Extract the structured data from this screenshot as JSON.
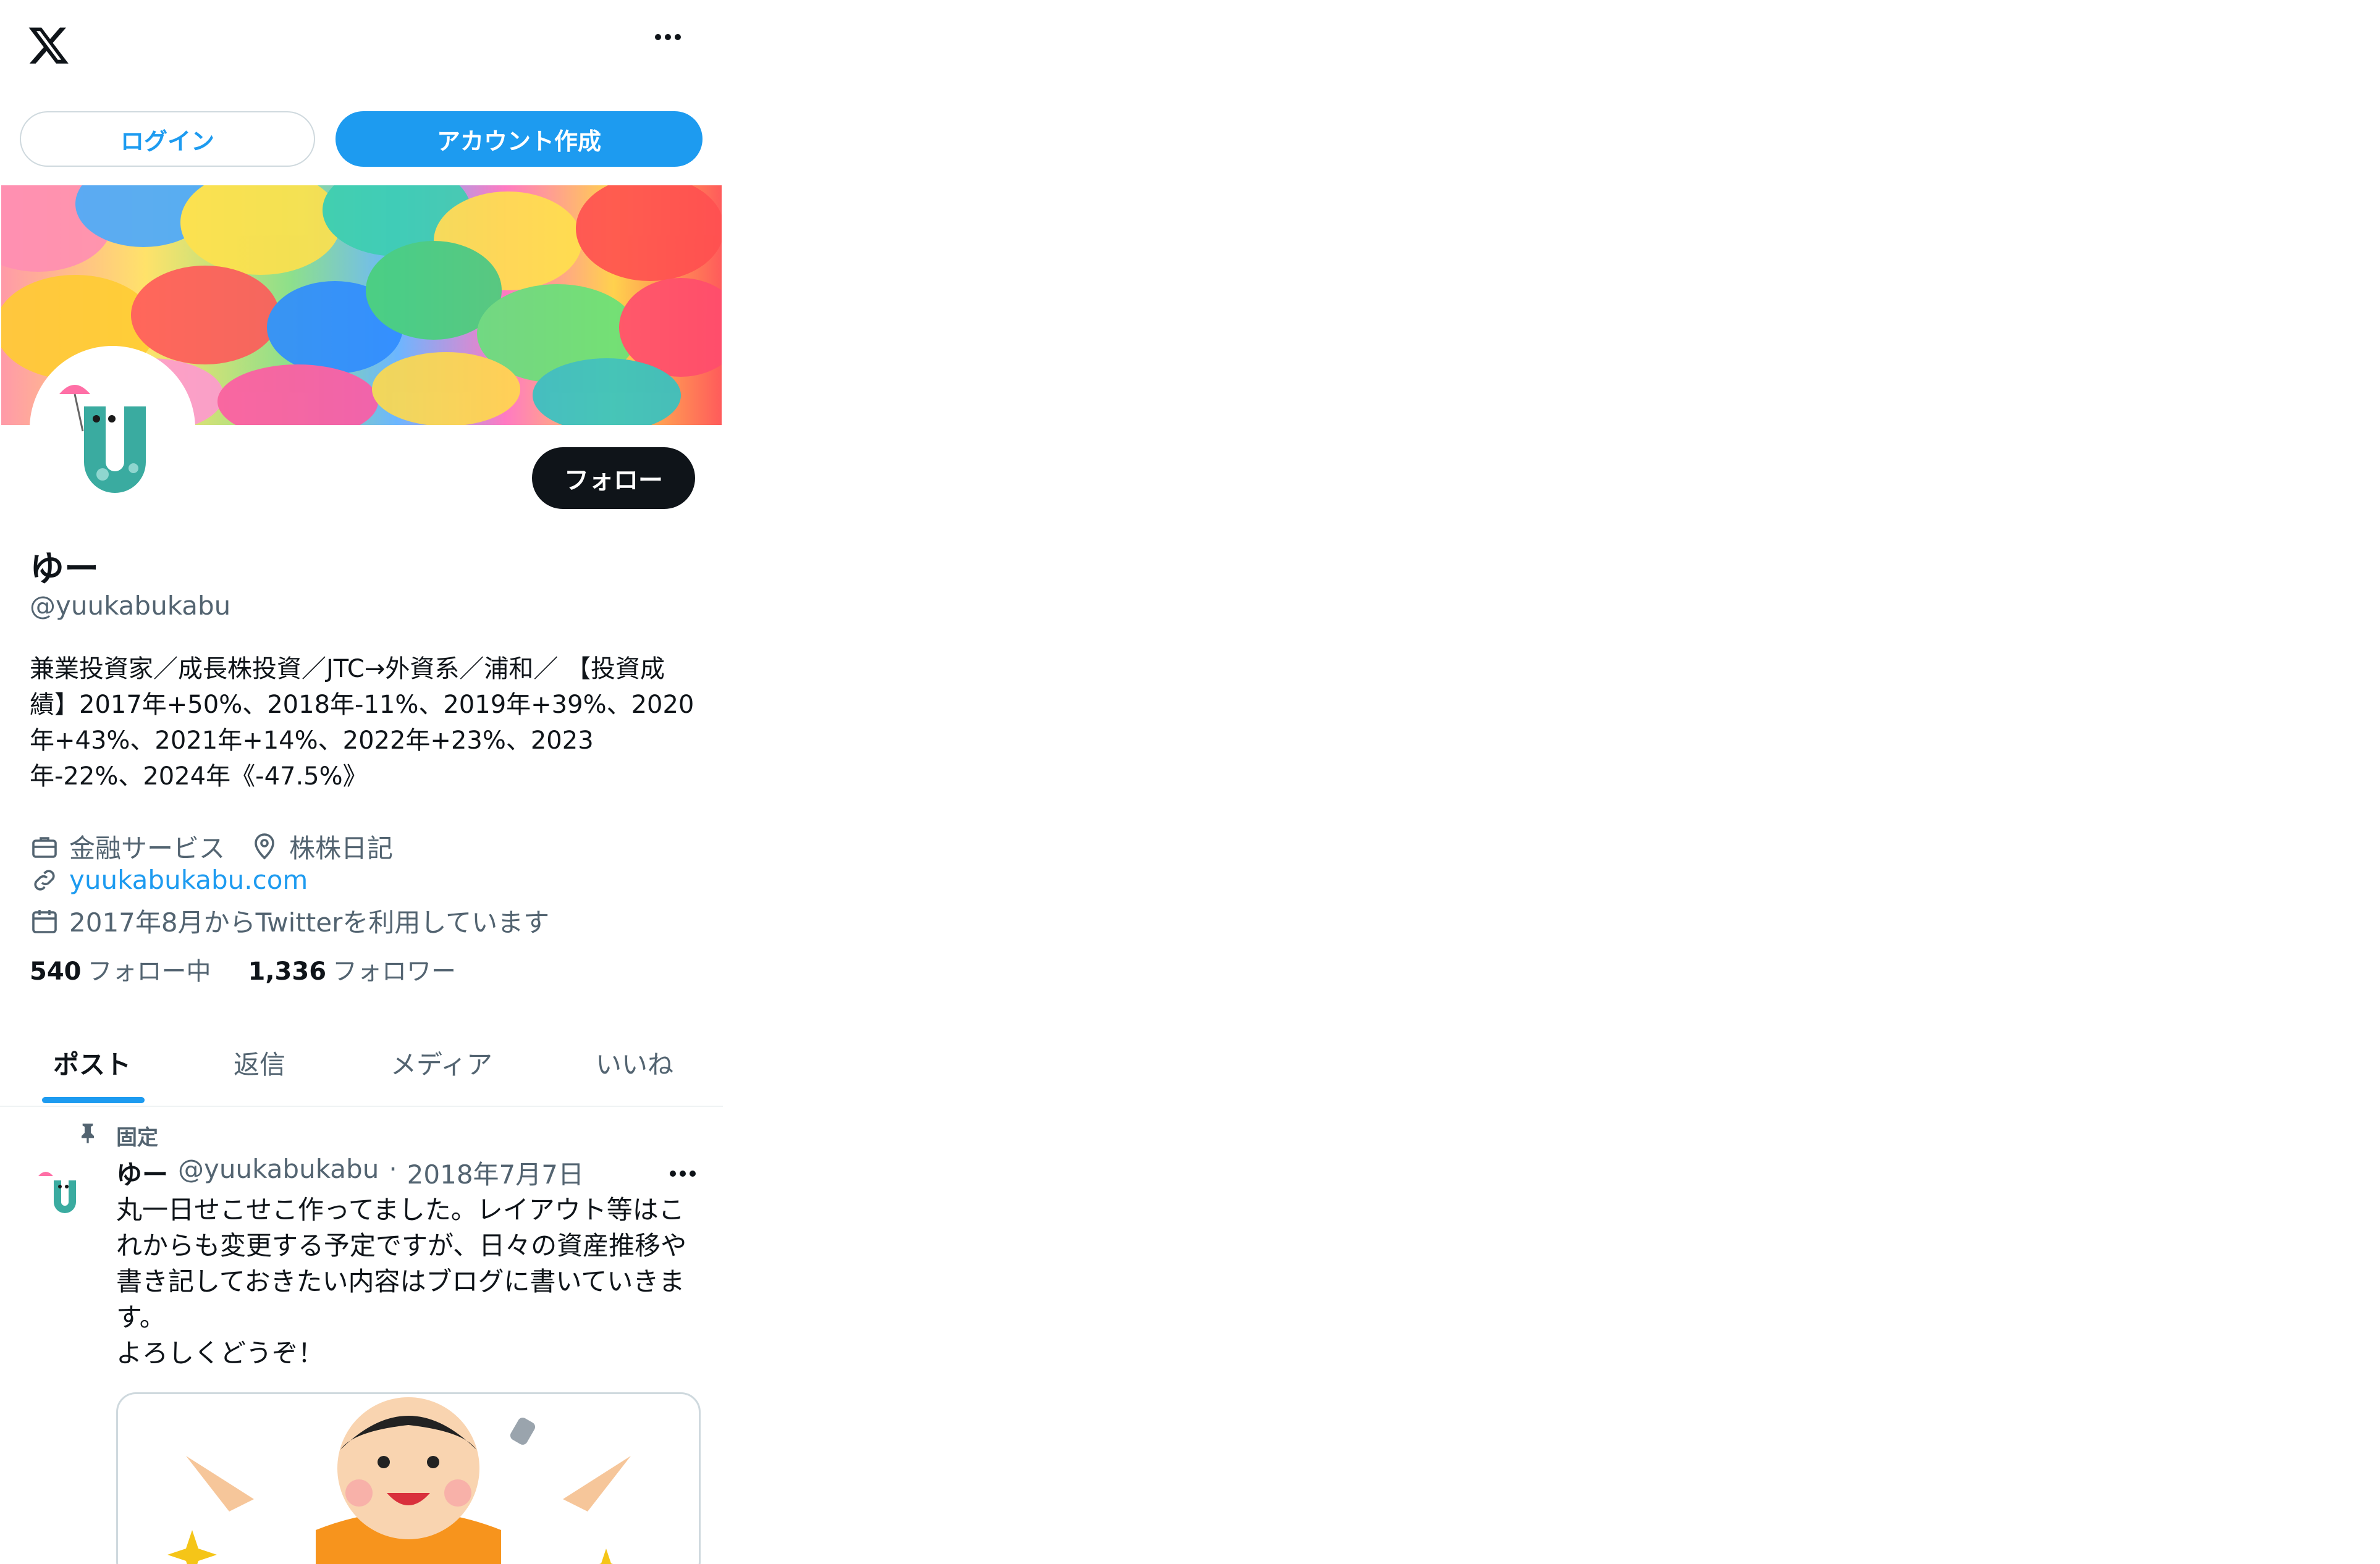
{
  "topbar": {
    "logo_icon": "x-logo-icon",
    "more_icon": "more-horizontal-icon"
  },
  "auth": {
    "login_label": "ログイン",
    "signup_label": "アカウント作成"
  },
  "profile": {
    "follow_label": "フォロー",
    "name": "ゆー",
    "handle": "@yuukabukabu",
    "bio": "兼業投資家／成長株投資／JTC→外資系／浦和／ 【投資成績】2017年+50%、2018年-11%、2019年+39%、2020年+43%、2021年+14%、2022年+23%、2023年-22%、2024年《-47.5%》",
    "category": "金融サービス",
    "location": "株株日記",
    "website": "yuukabukabu.com",
    "joined": "2017年8月からTwitterを利用しています",
    "following_count": "540",
    "following_label": "フォロー中",
    "followers_count": "1,336",
    "followers_label": "フォロワー"
  },
  "tabs": [
    {
      "label": "ポスト",
      "active": true
    },
    {
      "label": "返信",
      "active": false
    },
    {
      "label": "メディア",
      "active": false
    },
    {
      "label": "いいね",
      "active": false
    }
  ],
  "post": {
    "pinned_label": "固定",
    "author_name": "ゆー",
    "author_handle": "@yuukabukabu",
    "separator": "·",
    "date": "2018年7月7日",
    "text": "丸一日せこせこ作ってました。レイアウト等はこれからも変更する予定ですが、日々の資産推移や書き記しておきたい内容はブログに書いていきます。\nよろしくどうぞ！"
  },
  "colors": {
    "accent": "#1d9bf0",
    "text": "#0f1419",
    "muted": "#536471",
    "border": "#cfd9de"
  }
}
